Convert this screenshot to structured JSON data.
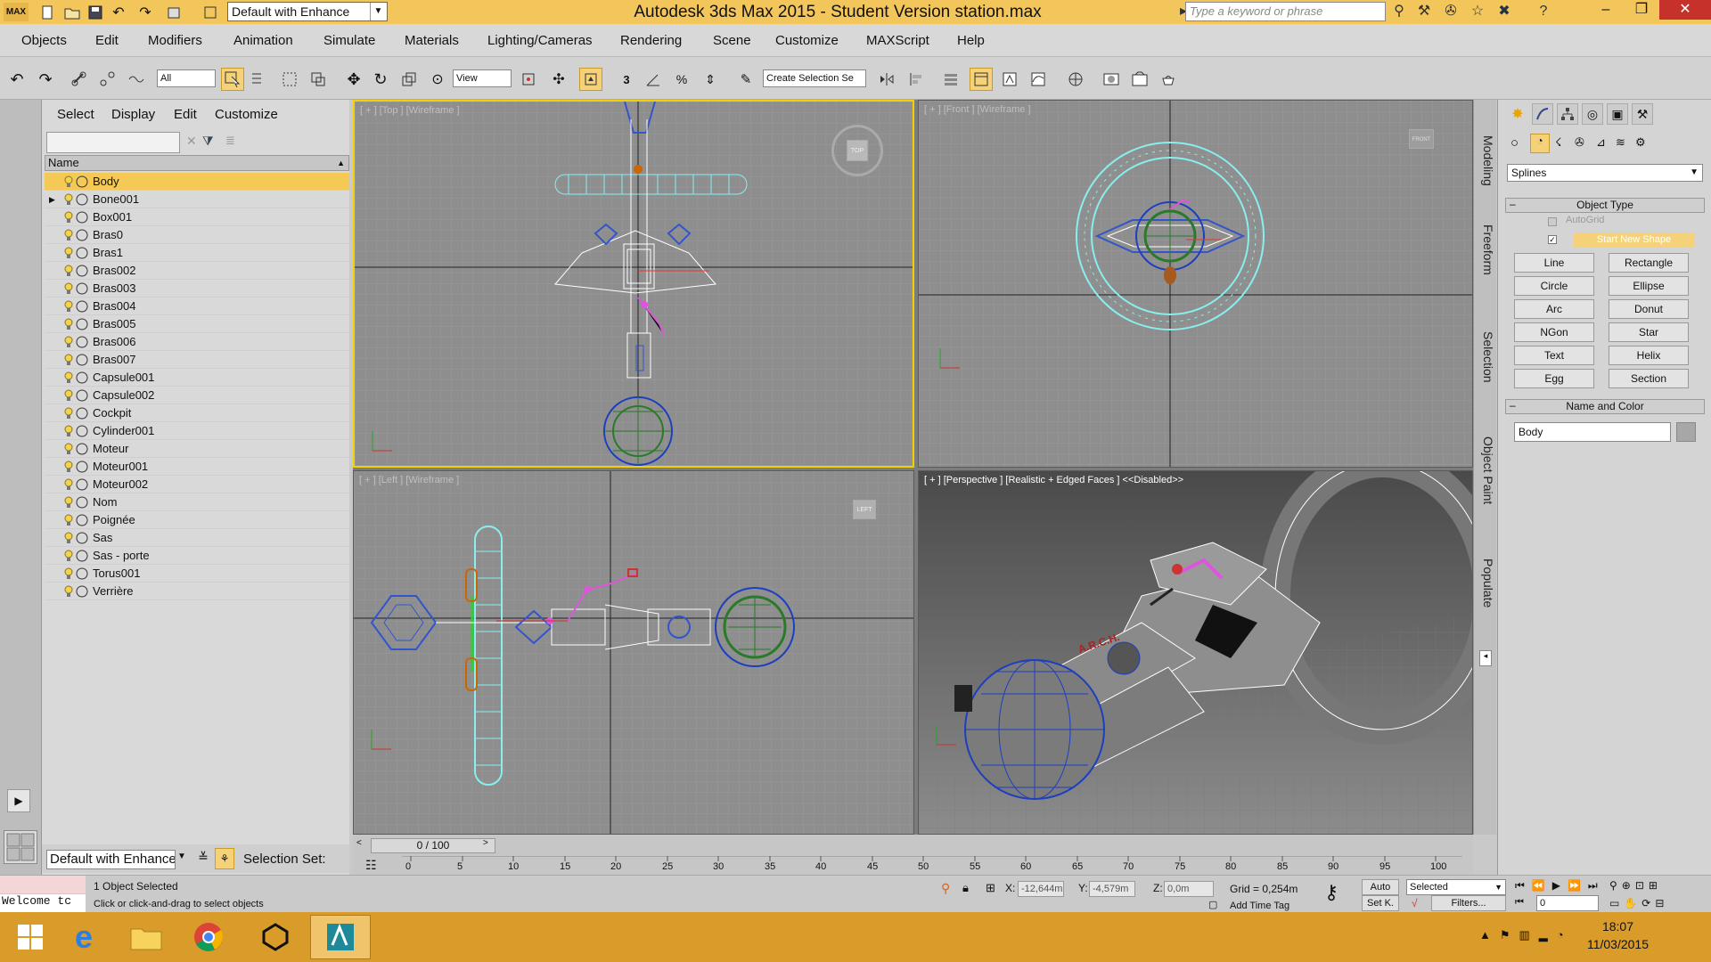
{
  "title_bar": {
    "workspace": "Default with Enhance",
    "app_title": "Autodesk 3ds Max  2015  - Student Version     station.max",
    "search_placeholder": "Type a keyword or phrase"
  },
  "menu": [
    "Objects",
    "Edit",
    "Modifiers",
    "Animation",
    "Simulate",
    "Materials",
    "Lighting/Cameras",
    "Rendering",
    "Scene",
    "Customize",
    "MAXScript",
    "Help"
  ],
  "toolbar": {
    "filter_value": "All",
    "ref_coord": "View",
    "selection_set": "Create Selection Se",
    "snap_label": "3"
  },
  "scene_explorer": {
    "menu": [
      "Select",
      "Display",
      "Edit",
      "Customize"
    ],
    "column_name": "Name",
    "selected": "Body",
    "objects": [
      "Body",
      "Bone001",
      "Box001",
      "Bras0",
      "Bras1",
      "Bras002",
      "Bras003",
      "Bras004",
      "Bras005",
      "Bras006",
      "Bras007",
      "Capsule001",
      "Capsule002",
      "Cockpit",
      "Cylinder001",
      "Moteur",
      "Moteur001",
      "Moteur002",
      "Nom",
      "Poignée",
      "Sas",
      "Sas - porte",
      "Torus001",
      "Verrière"
    ],
    "layer": "Default with Enhance",
    "selection_set_label": "Selection Set:"
  },
  "viewports": {
    "top": "[ + ] [Top ] [Wireframe ]",
    "front": "[ + ] [Front ] [Wireframe ]",
    "left": "[ + ] [Left ] [Wireframe ]",
    "perspective": "[ + ] [Perspective ] [Realistic + Edged Faces ]  <<Disabled>>",
    "viewcube_top": "TOP",
    "viewcube_front": "FRONT",
    "viewcube_left": "LEFT",
    "arch_text": "A.R.C.H."
  },
  "side_tabs": [
    "Modeling",
    "Freeform",
    "Selection",
    "Object Paint",
    "Populate"
  ],
  "command_panel": {
    "category": "Splines",
    "object_type_title": "Object Type",
    "autogrid": "AutoGrid",
    "start_new_shape": "Start New Shape",
    "buttons": [
      "Line",
      "Rectangle",
      "Circle",
      "Ellipse",
      "Arc",
      "Donut",
      "NGon",
      "Star",
      "Text",
      "Helix",
      "Egg",
      "Section"
    ],
    "name_color_title": "Name and Color",
    "name_value": "Body"
  },
  "timeline": {
    "frame": "0 / 100",
    "ticks": [
      "0",
      "5",
      "10",
      "15",
      "20",
      "25",
      "30",
      "35",
      "40",
      "45",
      "50",
      "55",
      "60",
      "65",
      "70",
      "75",
      "80",
      "85",
      "90",
      "95",
      "100"
    ]
  },
  "status": {
    "maxscript": "Welcome tc",
    "line1": "1 Object Selected",
    "line2": "Click or click-and-drag to select objects",
    "x_label": "X:",
    "x_value": "-12,644m",
    "y_label": "Y:",
    "y_value": "-4,579m",
    "z_label": "Z:",
    "z_value": "0,0m",
    "grid": "Grid = 0,254m",
    "add_time_tag": "Add Time Tag",
    "auto": "Auto",
    "set_key": "Set K.",
    "key_filter": "Selected",
    "filters": "Filters...",
    "frame_value": "0"
  },
  "taskbar": {
    "time": "18:07",
    "date": "11/03/2015"
  }
}
